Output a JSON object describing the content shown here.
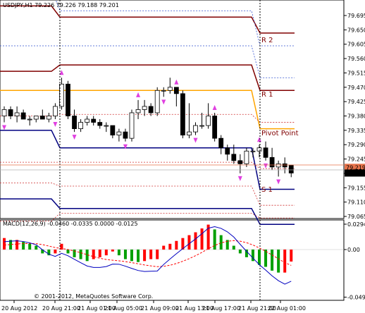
{
  "window": {
    "symbol_line": "USDJPY,H1  79.226 79.226 79.188 79.201",
    "copyright": "© 2001-2012, MetaQuotes Software Corp."
  },
  "price_axis": {
    "ticks": [
      "79.695",
      "79.650",
      "79.605",
      "79.560",
      "79.515",
      "79.470",
      "79.425",
      "79.380",
      "79.335",
      "79.290",
      "79.245",
      "79.200",
      "79.155",
      "79.110",
      "79.065"
    ],
    "badges": [
      {
        "text": "79.219",
        "color": "#e8734a"
      },
      {
        "text": "79.201",
        "color": "#000000"
      }
    ]
  },
  "macd_panel": {
    "title": "MACD(12,26,9) -0.0460 -0.0335 0.0000 -0.0125",
    "ticks": [
      "0.0294",
      "0.00",
      "-0.0496"
    ]
  },
  "time_axis": {
    "labels": [
      "20 Aug 2012",
      "20 Aug 21:00",
      "21 Aug 01:00",
      "21 Aug 05:00",
      "21 Aug 09:00",
      "21 Aug 13:00",
      "21 Aug 17:00",
      "21 Aug 21:00",
      "22 Aug 01:00"
    ]
  },
  "pivot_labels": {
    "r2": "R 2",
    "r1": "R 1",
    "pivot": "Pivot Point",
    "s1": "S 1"
  },
  "colors": {
    "r2": "#800000",
    "r1": "#800000",
    "pivot": "#ffa500",
    "s1": "#000080",
    "s2": "#000080",
    "dotted_blue": "#3050d0",
    "dotted_red": "#d03030",
    "price_line": "#e8734a",
    "macd_up": "#ff0000",
    "macd_down": "#00a000",
    "macd_signal": "#ff0000",
    "macd_line": "#0000c0",
    "fractal": "#e040e0",
    "period_separator": "#000000"
  },
  "chart_data": {
    "type": "candlestick",
    "symbol": "USDJPY",
    "timeframe": "H1",
    "last_bar": {
      "open": 79.226,
      "high": 79.226,
      "low": 79.188,
      "close": 79.201
    },
    "candles": [
      [
        79.38,
        79.41,
        79.36,
        79.4
      ],
      [
        79.4,
        79.41,
        79.37,
        79.38
      ],
      [
        79.38,
        79.41,
        79.36,
        79.39
      ],
      [
        79.39,
        79.4,
        79.37,
        79.37
      ],
      [
        79.37,
        79.38,
        79.35,
        79.37
      ],
      [
        79.37,
        79.38,
        79.36,
        79.38
      ],
      [
        79.38,
        79.4,
        79.37,
        79.37
      ],
      [
        79.37,
        79.39,
        79.36,
        79.38
      ],
      [
        79.38,
        79.42,
        79.37,
        79.41
      ],
      [
        79.41,
        79.5,
        79.4,
        79.48
      ],
      [
        79.48,
        79.49,
        79.37,
        79.38
      ],
      [
        79.38,
        79.4,
        79.33,
        79.34
      ],
      [
        79.34,
        79.37,
        79.33,
        79.36
      ],
      [
        79.36,
        79.38,
        79.35,
        79.37
      ],
      [
        79.37,
        79.38,
        79.35,
        79.36
      ],
      [
        79.36,
        79.37,
        79.34,
        79.35
      ],
      [
        79.35,
        79.36,
        79.33,
        79.35
      ],
      [
        79.35,
        79.35,
        79.31,
        79.32
      ],
      [
        79.32,
        79.34,
        79.3,
        79.33
      ],
      [
        79.33,
        79.34,
        79.3,
        79.31
      ],
      [
        79.31,
        79.4,
        79.3,
        79.39
      ],
      [
        79.39,
        79.43,
        79.37,
        79.4
      ],
      [
        79.4,
        79.43,
        79.38,
        79.41
      ],
      [
        79.41,
        79.42,
        79.38,
        79.39
      ],
      [
        79.39,
        79.47,
        79.38,
        79.46
      ],
      [
        79.46,
        79.47,
        79.44,
        79.46
      ],
      [
        79.46,
        79.5,
        79.45,
        79.47
      ],
      [
        79.47,
        79.47,
        79.41,
        79.45
      ],
      [
        79.45,
        79.46,
        79.31,
        79.32
      ],
      [
        79.32,
        79.42,
        79.31,
        79.33
      ],
      [
        79.33,
        79.36,
        79.32,
        79.35
      ],
      [
        79.35,
        79.39,
        79.34,
        79.35
      ],
      [
        79.35,
        79.42,
        79.34,
        79.38
      ],
      [
        79.38,
        79.39,
        79.3,
        79.31
      ],
      [
        79.31,
        79.32,
        79.26,
        79.28
      ],
      [
        79.28,
        79.29,
        79.24,
        79.26
      ],
      [
        79.26,
        79.29,
        79.23,
        79.24
      ],
      [
        79.24,
        79.26,
        79.2,
        79.23
      ],
      [
        79.23,
        79.28,
        79.22,
        79.27
      ],
      [
        79.27,
        79.28,
        79.25,
        79.27
      ],
      [
        79.27,
        79.29,
        79.25,
        79.28
      ],
      [
        79.28,
        79.3,
        79.24,
        79.25
      ],
      [
        79.25,
        79.28,
        79.21,
        79.22
      ],
      [
        79.22,
        79.24,
        79.19,
        79.23
      ],
      [
        79.23,
        79.25,
        79.2,
        79.22
      ],
      [
        79.226,
        79.226,
        79.188,
        79.201
      ]
    ],
    "pivot_levels": {
      "R2": [
        79.69,
        79.64
      ],
      "R1": [
        79.54,
        79.46
      ],
      "Pivot": [
        79.46,
        79.34
      ],
      "S1": [
        79.28,
        79.15
      ],
      "S2": [
        79.09,
        79.04
      ]
    },
    "macd_histogram": [
      0.012,
      0.01,
      0.01,
      0.008,
      0.006,
      0.004,
      -0.004,
      -0.006,
      -0.004,
      0.006,
      -0.004,
      -0.008,
      -0.01,
      -0.012,
      -0.01,
      -0.008,
      -0.006,
      -0.002,
      -0.006,
      -0.01,
      -0.012,
      -0.013,
      -0.012,
      -0.01,
      -0.01,
      0.004,
      0.006,
      0.009,
      0.012,
      0.015,
      0.018,
      0.022,
      0.026,
      0.021,
      0.015,
      0.01,
      0.004,
      -0.004,
      -0.008,
      -0.012,
      -0.016,
      -0.018,
      -0.022,
      -0.024,
      -0.024,
      -0.0125
    ],
    "macd_range": [
      -0.0496,
      0.0294
    ]
  }
}
